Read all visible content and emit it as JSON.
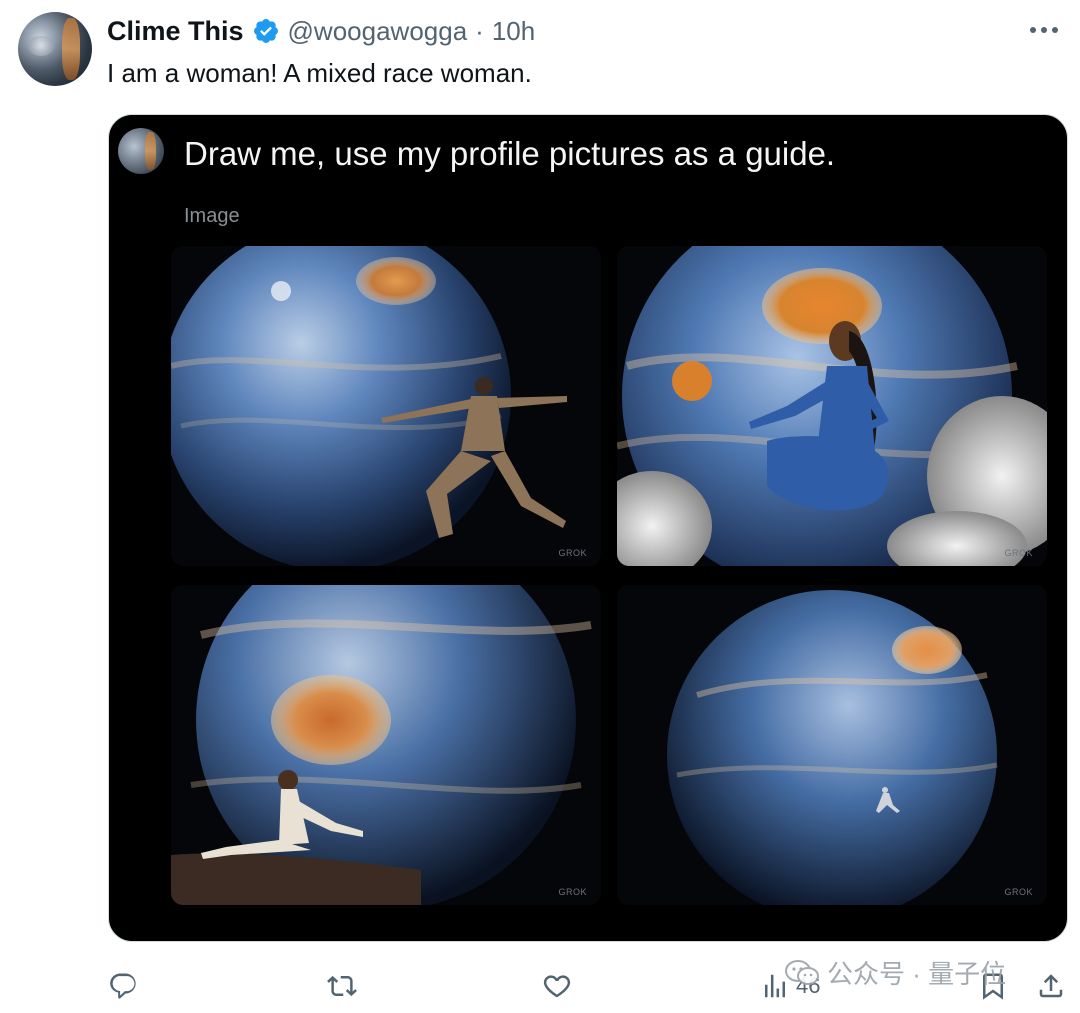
{
  "tweet": {
    "author_name": "Clime This",
    "handle": "@woogawogga",
    "separator": "·",
    "time": "10h",
    "text": "I am a woman! A mixed race woman."
  },
  "card": {
    "prompt": "Draw me, use my profile pictures as a guide.",
    "image_label": "Image",
    "tiles": [
      {
        "watermark": "GROK"
      },
      {
        "watermark": "GROK"
      },
      {
        "watermark": "GROK"
      },
      {
        "watermark": "GROK"
      }
    ]
  },
  "actions": {
    "views": "46"
  },
  "watermark": {
    "text": "公众号 · 量子位"
  },
  "colors": {
    "verified": "#1d9bf0",
    "secondary_text": "#536471",
    "card_bg": "#000000"
  }
}
